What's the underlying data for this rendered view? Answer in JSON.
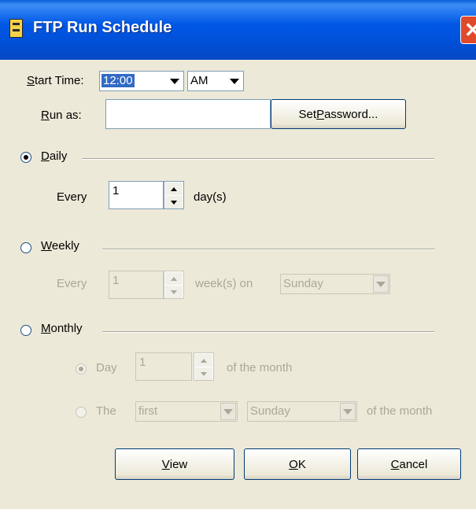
{
  "window": {
    "title": "FTP Run Schedule",
    "close_glyph": "✕"
  },
  "start_time": {
    "label_underlined": "S",
    "label_rest": "tart Time:",
    "time_value": "12:00",
    "ampm_value": "AM"
  },
  "run_as": {
    "label_underlined": "R",
    "label_rest": "un as:",
    "value": "",
    "set_password_pre": "Set ",
    "set_password_u": "P",
    "set_password_post": "assword..."
  },
  "daily": {
    "label_u": "D",
    "label_rest": "aily",
    "selected": true,
    "every_label": "Every",
    "every_value": "1",
    "unit": "day(s)"
  },
  "weekly": {
    "label_u": "W",
    "label_rest": "eekly",
    "selected": false,
    "every_label": "Every",
    "every_value": "1",
    "unit": "week(s) on",
    "day_value": "Sunday"
  },
  "monthly": {
    "label_u": "M",
    "label_rest": "onthly",
    "selected": false,
    "day_option": {
      "label": "Day",
      "value": "1",
      "suffix": "of the month",
      "selected": true
    },
    "the_option": {
      "label": "The",
      "ordinal_value": "first",
      "weekday_value": "Sunday",
      "suffix": "of the month",
      "selected": false
    }
  },
  "buttons": {
    "view_u": "V",
    "view_rest": "iew",
    "ok_u": "O",
    "ok_rest": "K",
    "cancel_u": "C",
    "cancel_rest": "ancel"
  }
}
